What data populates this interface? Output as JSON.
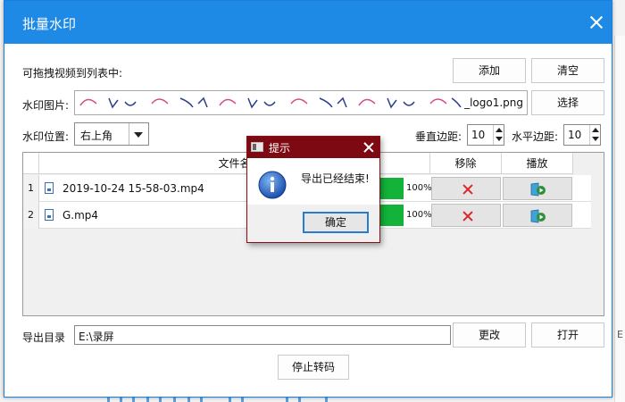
{
  "window": {
    "title": "批量水印"
  },
  "top": {
    "drag_hint": "可拖拽视频到列表中:",
    "add_label": "添加",
    "clear_label": "清空"
  },
  "watermark_image": {
    "label": "水印图片:",
    "filename": "_logo1.png",
    "select_label": "选择"
  },
  "position": {
    "label": "水印位置:",
    "value": "右上角"
  },
  "margins": {
    "vertical_label": "垂直边距:",
    "vertical_value": "10",
    "horizontal_label": "水平边距:",
    "horizontal_value": "10"
  },
  "table": {
    "columns": {
      "filename": "文件名",
      "remove": "移除",
      "play": "播放"
    },
    "rows": [
      {
        "index": "1",
        "filename": "2019-10-24 15-58-03.mp4",
        "progress": 100,
        "percent_text": "100%"
      },
      {
        "index": "2",
        "filename": "G.mp4",
        "progress": 100,
        "percent_text": "100%"
      }
    ]
  },
  "output": {
    "label": "导出目录",
    "path": "E:\\录屏",
    "change_label": "更改",
    "open_label": "打开"
  },
  "stop_label": "停止转码",
  "dialog": {
    "title": "提示",
    "message": "导出已经结束!",
    "ok_label": "确定"
  },
  "colors": {
    "titlebar": "#1e8ae6",
    "dialog_titlebar": "#7d0a12",
    "progress": "#13b33a",
    "remove": "#e02525"
  }
}
